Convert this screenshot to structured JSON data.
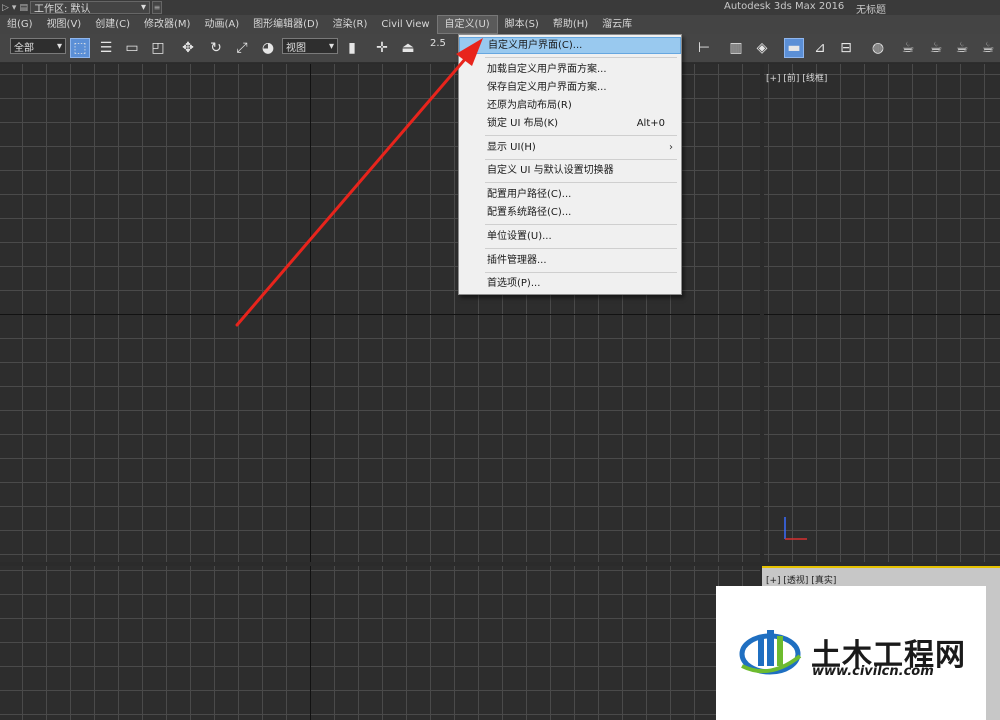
{
  "titlebar": {
    "workspace_label": "工作区: 默认",
    "app_title": "Autodesk 3ds Max 2016",
    "doc_title": "无标题"
  },
  "menubar": {
    "items": [
      {
        "label": "组(G)"
      },
      {
        "label": "视图(V)"
      },
      {
        "label": "创建(C)"
      },
      {
        "label": "修改器(M)"
      },
      {
        "label": "动画(A)"
      },
      {
        "label": "图形编辑器(D)"
      },
      {
        "label": "渲染(R)"
      },
      {
        "label": "Civil View"
      },
      {
        "label": "自定义(U)"
      },
      {
        "label": "脚本(S)"
      },
      {
        "label": "帮助(H)"
      },
      {
        "label": "溜云库"
      }
    ]
  },
  "toolbar": {
    "selection_filter": "全部",
    "reference_coord": "视图",
    "snap_value": "2.5"
  },
  "customize_menu": {
    "items": [
      {
        "label": "自定义用户界面(C)...",
        "highlighted": true
      },
      {
        "label": "加载自定义用户界面方案..."
      },
      {
        "label": "保存自定义用户界面方案..."
      },
      {
        "label": "还原为启动布局(R)"
      },
      {
        "label": "锁定 UI 布局(K)",
        "shortcut": "Alt+0"
      },
      {
        "label": "显示 UI(H)",
        "submenu": true
      },
      {
        "label": "自定义 UI 与默认设置切换器"
      },
      {
        "label": "配置用户路径(C)..."
      },
      {
        "label": "配置系统路径(C)..."
      },
      {
        "label": "单位设置(U)..."
      },
      {
        "label": "插件管理器..."
      },
      {
        "label": "首选项(P)..."
      }
    ]
  },
  "viewports": {
    "right_label": "[+] [前] [线框]",
    "bottom_right_label": "[+] [透视] [真实]"
  },
  "watermark": {
    "name": "土木工程网",
    "url": "www.civilcn.com"
  },
  "colors": {
    "highlight": "#99c9ef",
    "annotation_arrow": "#e8241c",
    "active_viewport_border": "#e6c200",
    "logo_blue": "#1f6fc1",
    "logo_green": "#6dbb2f"
  }
}
